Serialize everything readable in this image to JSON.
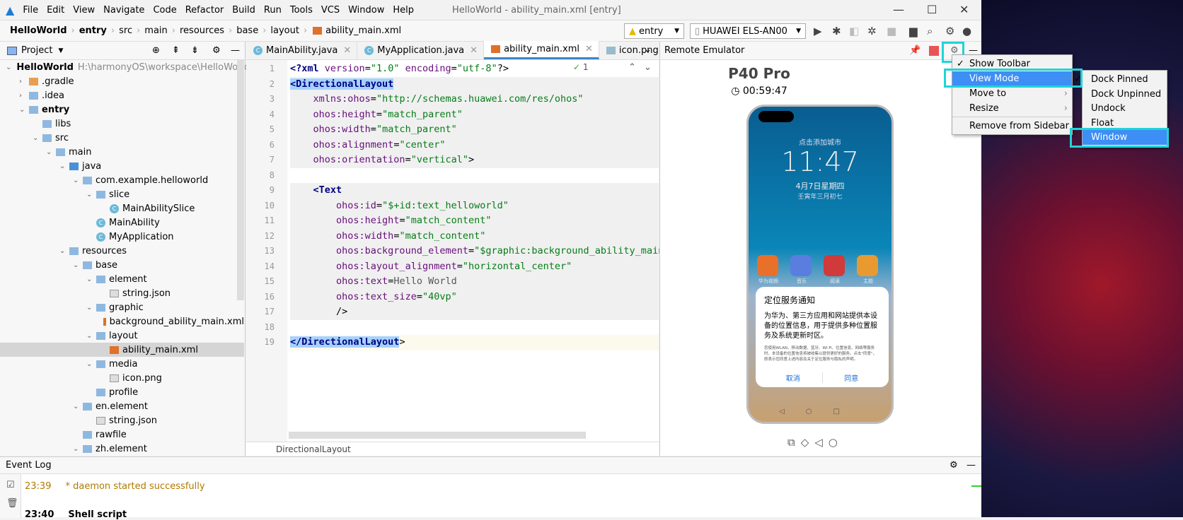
{
  "menubar": {
    "items": [
      "File",
      "Edit",
      "View",
      "Navigate",
      "Code",
      "Refactor",
      "Build",
      "Run",
      "Tools",
      "VCS",
      "Window",
      "Help"
    ],
    "title": "HelloWorld - ability_main.xml [entry]"
  },
  "breadcrumb": [
    "HelloWorld",
    "entry",
    "src",
    "main",
    "resources",
    "base",
    "layout",
    "ability_main.xml"
  ],
  "toolbar": {
    "config": "entry",
    "device": "HUAWEI ELS-AN00"
  },
  "project": {
    "title": "Project",
    "tree": [
      {
        "label": "HelloWorld",
        "extra": "H:\\harmonyOS\\workspace\\HelloWorld",
        "d": 0,
        "open": true,
        "bold": true,
        "icon": "folder"
      },
      {
        "label": ".gradle",
        "d": 1,
        "open": false,
        "icon": "folder-orange"
      },
      {
        "label": ".idea",
        "d": 1,
        "open": false,
        "icon": "folder"
      },
      {
        "label": "entry",
        "d": 1,
        "open": true,
        "bold": true,
        "icon": "folder"
      },
      {
        "label": "libs",
        "d": 2,
        "icon": "folder"
      },
      {
        "label": "src",
        "d": 2,
        "open": true,
        "icon": "folder"
      },
      {
        "label": "main",
        "d": 3,
        "open": true,
        "icon": "folder"
      },
      {
        "label": "java",
        "d": 4,
        "open": true,
        "icon": "folder-blue"
      },
      {
        "label": "com.example.helloworld",
        "d": 5,
        "open": true,
        "icon": "folder"
      },
      {
        "label": "slice",
        "d": 6,
        "open": true,
        "icon": "folder"
      },
      {
        "label": "MainAbilitySlice",
        "d": 7,
        "icon": "class"
      },
      {
        "label": "MainAbility",
        "d": 6,
        "icon": "class"
      },
      {
        "label": "MyApplication",
        "d": 6,
        "icon": "class"
      },
      {
        "label": "resources",
        "d": 4,
        "open": true,
        "icon": "folder"
      },
      {
        "label": "base",
        "d": 5,
        "open": true,
        "icon": "folder"
      },
      {
        "label": "element",
        "d": 6,
        "open": true,
        "icon": "folder"
      },
      {
        "label": "string.json",
        "d": 7,
        "icon": "file"
      },
      {
        "label": "graphic",
        "d": 6,
        "open": true,
        "icon": "folder"
      },
      {
        "label": "background_ability_main.xml",
        "d": 7,
        "icon": "xml"
      },
      {
        "label": "layout",
        "d": 6,
        "open": true,
        "icon": "folder"
      },
      {
        "label": "ability_main.xml",
        "d": 7,
        "icon": "xml",
        "selected": true
      },
      {
        "label": "media",
        "d": 6,
        "open": true,
        "icon": "folder"
      },
      {
        "label": "icon.png",
        "d": 7,
        "icon": "file"
      },
      {
        "label": "profile",
        "d": 6,
        "icon": "folder"
      },
      {
        "label": "en.element",
        "d": 5,
        "open": true,
        "icon": "folder"
      },
      {
        "label": "string.json",
        "d": 6,
        "icon": "file"
      },
      {
        "label": "rawfile",
        "d": 5,
        "icon": "folder"
      },
      {
        "label": "zh.element",
        "d": 5,
        "open": true,
        "icon": "folder"
      }
    ]
  },
  "tabs": [
    {
      "label": "MainAbility.java",
      "icon": "class"
    },
    {
      "label": "MyApplication.java",
      "icon": "class"
    },
    {
      "label": "ability_main.xml",
      "icon": "xml",
      "active": true
    },
    {
      "label": "icon.png",
      "icon": "image"
    }
  ],
  "editor": {
    "inspection_count": "1",
    "footer": "DirectionalLayout",
    "lines": [
      "<?xml version=\"1.0\" encoding=\"utf-8\"?>",
      "<DirectionalLayout",
      "    xmlns:ohos=\"http://schemas.huawei.com/res/ohos\"",
      "    ohos:height=\"match_parent\"",
      "    ohos:width=\"match_parent\"",
      "    ohos:alignment=\"center\"",
      "    ohos:orientation=\"vertical\">",
      "",
      "    <Text",
      "        ohos:id=\"$+id:text_helloworld\"",
      "        ohos:height=\"match_content\"",
      "        ohos:width=\"match_content\"",
      "        ohos:background_element=\"$graphic:background_ability_main\"",
      "        ohos:layout_alignment=\"horizontal_center\"",
      "        ohos:text=Hello World",
      "        ohos:text_size=\"40vp\"",
      "        />",
      "",
      "</DirectionalLayout>"
    ]
  },
  "emulator": {
    "title": "Remote Emulator",
    "model": "P40 Pro",
    "timer": "00:59:47",
    "screen": {
      "city": "点击添加城市",
      "time": "11:47",
      "date": "4月7日星期四",
      "lunar": "壬寅年三月初七",
      "apps": [
        "华为视频",
        "音乐",
        "阅读",
        "主题"
      ],
      "dialog": {
        "title": "定位服务通知",
        "body": "为华为、第三方应用和网站提供本设备的位置信息，用于提供多种位置服务及系统更新时区。",
        "fine": "您使用WLAN、移动数据、蓝牙、Wi-Fi、位置信息、网络等服务时，本设备的位置信息将被收集以提供更好的服务。点击\"同意\"，即表示您同意上述内容及关于定位服务与隐私的声明。",
        "cancel": "取消",
        "agree": "同意"
      }
    }
  },
  "menu": {
    "items": [
      {
        "label": "Show Toolbar",
        "checked": true
      },
      {
        "label": "View Mode",
        "submenu": true,
        "active": true
      },
      {
        "label": "Move to",
        "submenu": true
      },
      {
        "label": "Resize",
        "submenu": true
      },
      {
        "label": "Remove from Sidebar"
      }
    ],
    "submenu": [
      {
        "label": "Dock Pinned",
        "checked": true
      },
      {
        "label": "Dock Unpinned"
      },
      {
        "label": "Undock"
      },
      {
        "label": "Float"
      },
      {
        "label": "Window",
        "active": true
      }
    ]
  },
  "eventlog": {
    "title": "Event Log",
    "entries": [
      {
        "time": "23:39",
        "text": "* daemon started successfully",
        "color": "#b07a00"
      },
      {
        "time": "23:40",
        "text": "Shell script",
        "bold": true
      }
    ]
  },
  "colors": {
    "accent": "#3d8ef5",
    "highlight": "#22d3d8"
  }
}
